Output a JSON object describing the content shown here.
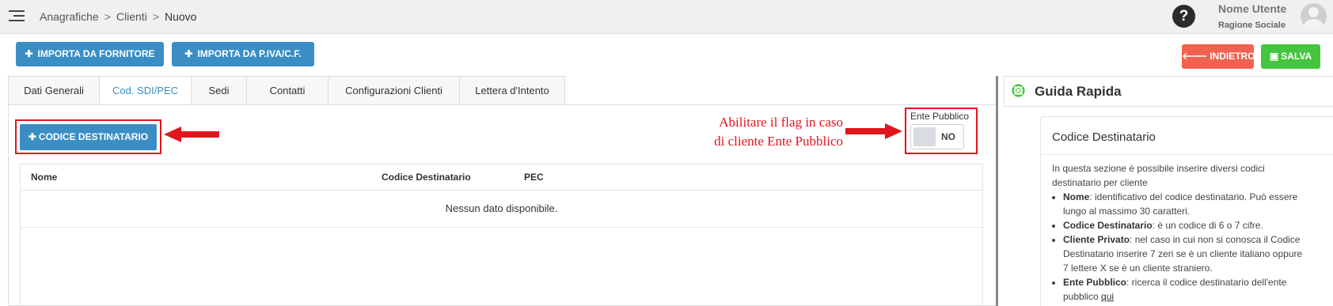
{
  "header": {
    "breadcrumb": [
      "Anagrafiche",
      "Clienti",
      "Nuovo"
    ],
    "help_label": "?",
    "user_name": "Nome Utente",
    "user_company": "Ragione Sociale"
  },
  "toolbar": {
    "import_supplier": "IMPORTA DA FORNITORE",
    "import_vat": "IMPORTA DA P.IVA/C.F.",
    "back": "INDIETRO",
    "save": "SALVA"
  },
  "tabs": [
    {
      "label": "Dati Generali",
      "active": false
    },
    {
      "label": "Cod. SDI/PEC",
      "active": true
    },
    {
      "label": "Sedi",
      "active": false
    },
    {
      "label": "Contatti",
      "active": false
    },
    {
      "label": "Configurazioni Clienti",
      "active": false
    },
    {
      "label": "Lettera d'Intento",
      "active": false
    }
  ],
  "content": {
    "add_button": "CODICE DESTINATARIO",
    "annotation_line1": "Abilitare il flag in caso",
    "annotation_line2": "di cliente Ente Pubblico",
    "public_entity_label": "Ente Pubblico",
    "toggle_value": "NO",
    "table": {
      "columns": [
        "Nome",
        "Codice Destinatario",
        "PEC"
      ],
      "empty_message": "Nessun dato disponibile."
    }
  },
  "guide": {
    "title": "Guida Rapida",
    "card_title": "Codice Destinatario",
    "intro": "In questa sezione è possibile inserire diversi codici destinatario per cliente",
    "items": [
      {
        "term": "Nome",
        "text": ": identificativo del codice destinatario. Può essere lungo al massimo 30 caratteri."
      },
      {
        "term": "Codice Destinatario",
        "text": ": è un codice di 6 o 7 cifre."
      },
      {
        "term": "Cliente Privato",
        "text": ": nel caso in cui non si conosca il Codice Destinatario inserire 7 zeri se è un cliente italiano oppure 7 lettere X se è un cliente straniero."
      },
      {
        "term": "Ente Pubblico",
        "text": ": ricerca il codice destinatario dell'ente pubblico "
      }
    ],
    "link_text": "qui"
  },
  "colors": {
    "primary": "#3b8ec4",
    "danger": "#f0624f",
    "success": "#45c53f",
    "annotation": "#e0161e"
  }
}
